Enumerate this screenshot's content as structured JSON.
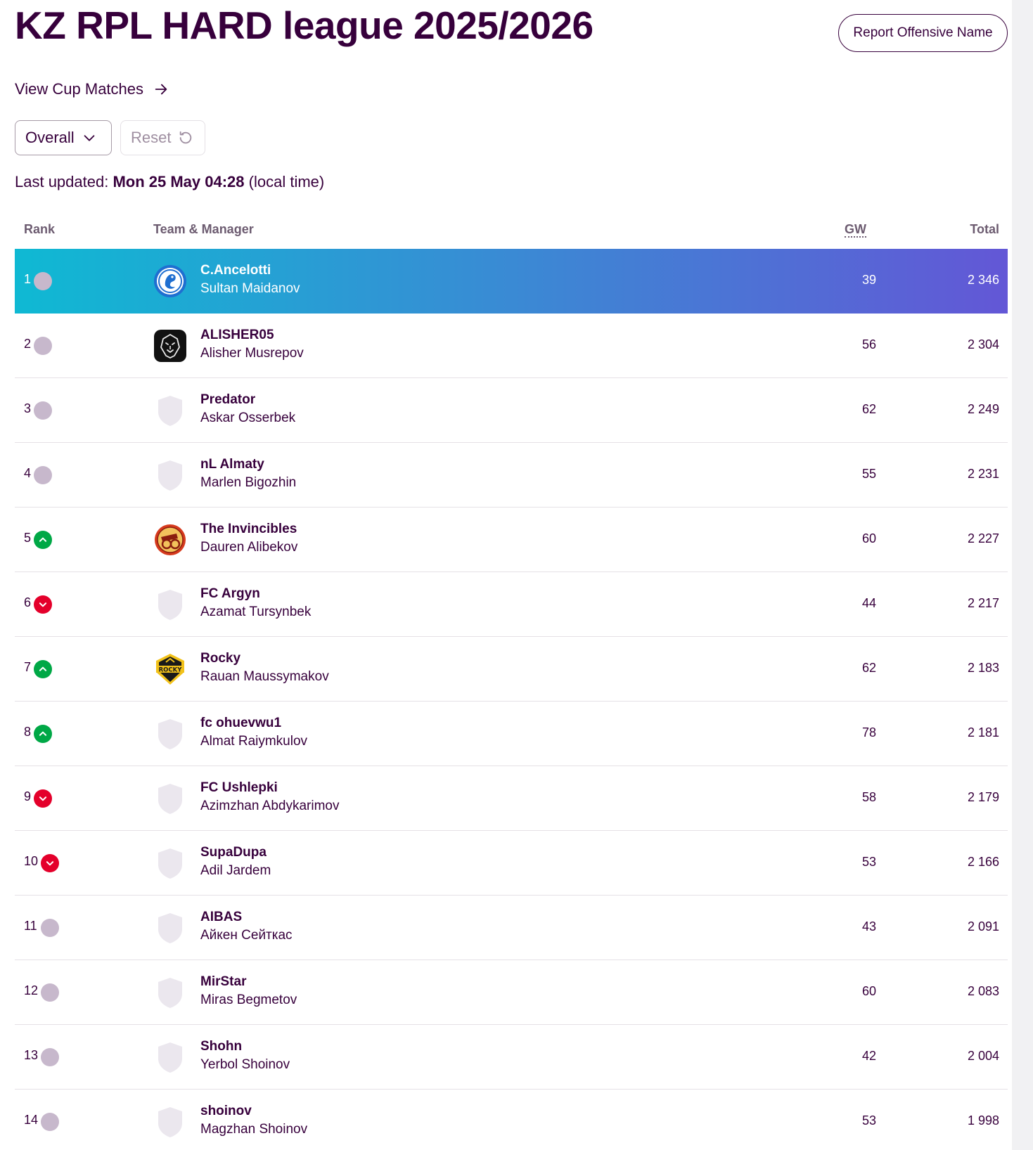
{
  "league_title": "KZ RPL HARD league 2025/2026",
  "report_button": "Report Offensive Name",
  "cup_link": "View Cup Matches",
  "filter": {
    "selected": "Overall",
    "reset_label": "Reset"
  },
  "updated": {
    "prefix": "Last updated: ",
    "datetime": "Mon 25 May 04:28",
    "suffix": " (local time)"
  },
  "columns": {
    "rank": "Rank",
    "team": "Team & Manager",
    "gw": "GW",
    "total": "Total"
  },
  "colors": {
    "primary": "#37003c",
    "up": "#00a846",
    "down": "#e4002b",
    "same": "#c7b8cc",
    "highlight_start": "#0fb9d3",
    "highlight_end": "#6357d6"
  },
  "standings": [
    {
      "rank": "1",
      "movement": "same",
      "badge": "crest-icon",
      "team": "C.Ancelotti",
      "manager": "Sultan Maidanov",
      "gw": "39",
      "total": "2 346"
    },
    {
      "rank": "2",
      "movement": "same",
      "badge": "lion-icon",
      "team": "ALISHER05",
      "manager": "Alisher Musrepov",
      "gw": "56",
      "total": "2 304"
    },
    {
      "rank": "3",
      "movement": "same",
      "badge": "shield-placeholder-icon",
      "team": "Predator",
      "manager": "Askar Osserbek",
      "gw": "62",
      "total": "2 249"
    },
    {
      "rank": "4",
      "movement": "same",
      "badge": "shield-placeholder-icon",
      "team": "nL Almaty",
      "manager": "Marlen Bigozhin",
      "gw": "55",
      "total": "2 231"
    },
    {
      "rank": "5",
      "movement": "up",
      "badge": "cannon-icon",
      "team": "The Invincibles",
      "manager": "Dauren Alibekov",
      "gw": "60",
      "total": "2 227"
    },
    {
      "rank": "6",
      "movement": "down",
      "badge": "shield-placeholder-icon",
      "team": "FC Argyn",
      "manager": "Azamat Tursynbek",
      "gw": "44",
      "total": "2 217"
    },
    {
      "rank": "7",
      "movement": "up",
      "badge": "rocky-icon",
      "team": "Rocky",
      "manager": "Rauan Maussymakov",
      "gw": "62",
      "total": "2 183"
    },
    {
      "rank": "8",
      "movement": "up",
      "badge": "shield-placeholder-icon",
      "team": "fc ohuevwu1",
      "manager": "Almat Raiymkulov",
      "gw": "78",
      "total": "2 181"
    },
    {
      "rank": "9",
      "movement": "down",
      "badge": "shield-placeholder-icon",
      "team": "FC Ushlepki",
      "manager": "Azimzhan Abdykarimov",
      "gw": "58",
      "total": "2 179"
    },
    {
      "rank": "10",
      "movement": "down",
      "badge": "shield-placeholder-icon",
      "team": "SupaDupa",
      "manager": "Adil Jardem",
      "gw": "53",
      "total": "2 166"
    },
    {
      "rank": "11",
      "movement": "same",
      "badge": "shield-placeholder-icon",
      "team": "AIBAS",
      "manager": "Айкен Сейткас",
      "gw": "43",
      "total": "2 091"
    },
    {
      "rank": "12",
      "movement": "same",
      "badge": "shield-placeholder-icon",
      "team": "MirStar",
      "manager": "Miras Begmetov",
      "gw": "60",
      "total": "2 083"
    },
    {
      "rank": "13",
      "movement": "same",
      "badge": "shield-placeholder-icon",
      "team": "Shohn",
      "manager": "Yerbol Shoinov",
      "gw": "42",
      "total": "2 004"
    },
    {
      "rank": "14",
      "movement": "same",
      "badge": "shield-placeholder-icon",
      "team": "shoinov",
      "manager": "Magzhan Shoinov",
      "gw": "53",
      "total": "1 998"
    }
  ]
}
